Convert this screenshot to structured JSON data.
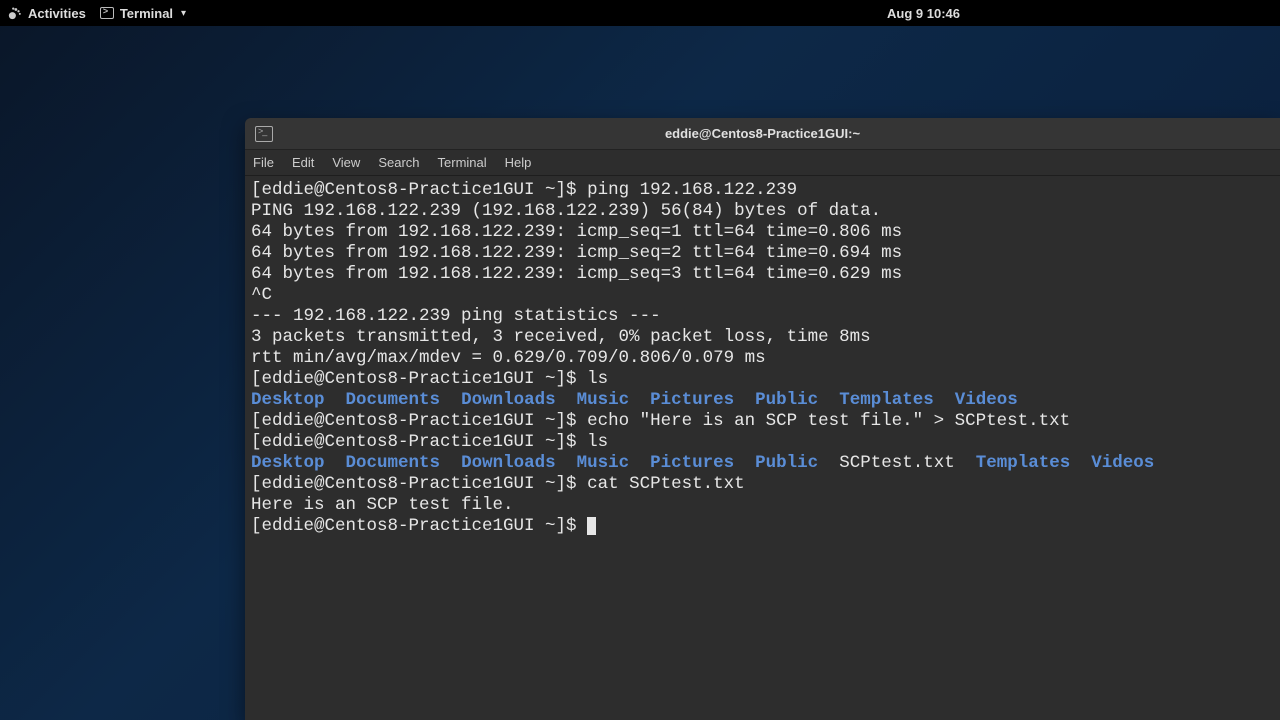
{
  "topbar": {
    "activities": "Activities",
    "app_name": "Terminal",
    "datetime": "Aug 9  10:46"
  },
  "window": {
    "title": "eddie@Centos8-Practice1GUI:~"
  },
  "menubar": {
    "file": "File",
    "edit": "Edit",
    "view": "View",
    "search": "Search",
    "terminal": "Terminal",
    "help": "Help"
  },
  "term": {
    "prompt": "[eddie@Centos8-Practice1GUI ~]$ ",
    "cmd_ping": "ping 192.168.122.239",
    "ping_header": "PING 192.168.122.239 (192.168.122.239) 56(84) bytes of data.",
    "ping1": "64 bytes from 192.168.122.239: icmp_seq=1 ttl=64 time=0.806 ms",
    "ping2": "64 bytes from 192.168.122.239: icmp_seq=2 ttl=64 time=0.694 ms",
    "ping3": "64 bytes from 192.168.122.239: icmp_seq=3 ttl=64 time=0.629 ms",
    "ctrlc": "^C",
    "stats_sep": "--- 192.168.122.239 ping statistics ---",
    "stats1": "3 packets transmitted, 3 received, 0% packet loss, time 8ms",
    "stats2": "rtt min/avg/max/mdev = 0.629/0.709/0.806/0.079 ms",
    "cmd_ls": "ls",
    "cmd_echo": "echo \"Here is an SCP test file.\" > SCPtest.txt",
    "cmd_ls2": "ls",
    "cmd_cat": "cat SCPtest.txt",
    "cat_out": "Here is an SCP test file.",
    "scpfile": "SCPtest.txt",
    "dirs": {
      "desktop": "Desktop",
      "documents": "Documents",
      "downloads": "Downloads",
      "music": "Music",
      "pictures": "Pictures",
      "public": "Public",
      "templates": "Templates",
      "videos": "Videos"
    }
  }
}
